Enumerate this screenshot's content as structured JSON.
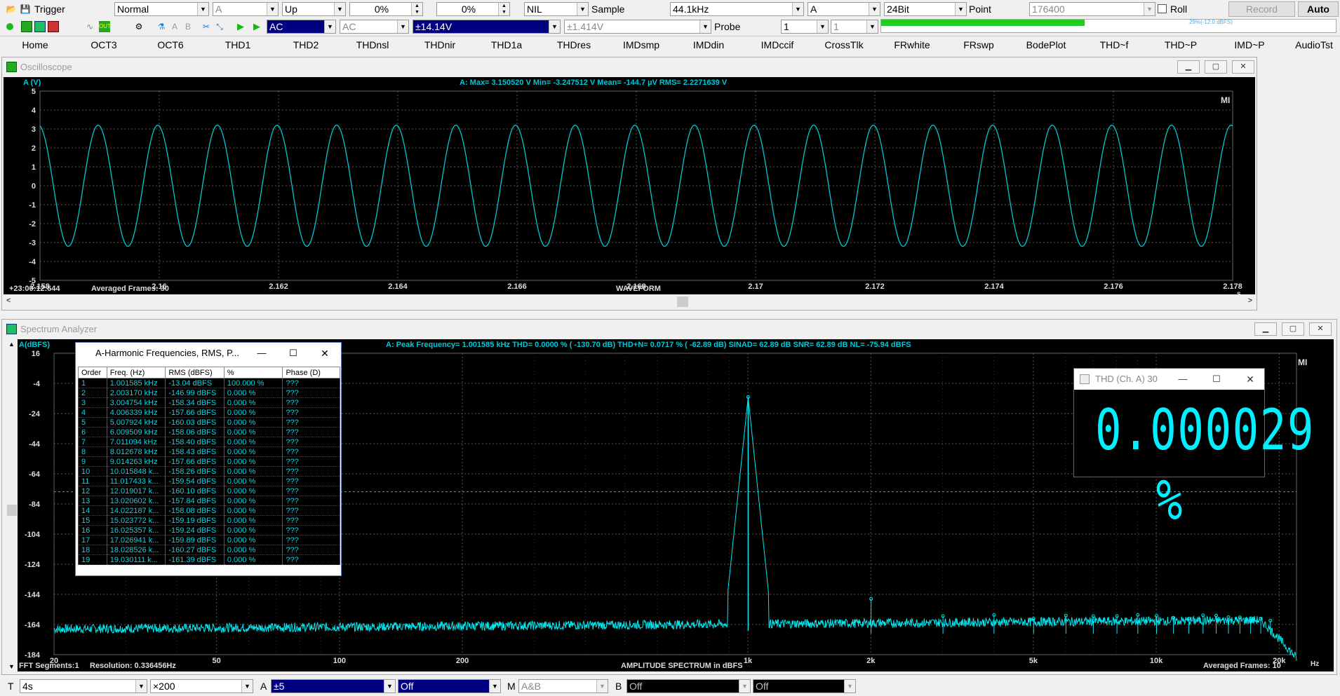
{
  "toolbar": {
    "trigger_label": "Trigger",
    "mode": "Normal",
    "channel": "A",
    "edge": "Up",
    "level1": "0%",
    "level2": "0%",
    "window": "NIL",
    "sample_label": "Sample",
    "sample_rate": "44.1kHz",
    "sample_channel": "A",
    "bits": "24Bit",
    "point_label": "Point",
    "points": "176400",
    "roll_label": "Roll",
    "record_label": "Record",
    "auto_label": "Auto",
    "coupling": "AC",
    "coupling2": "AC",
    "range": "±14.14V",
    "range2": "±1.414V",
    "probe_label": "Probe",
    "probe1": "1",
    "probe2": "1",
    "level_meter_text": "29%(-12.0 dBFS)"
  },
  "tabs": [
    "Home",
    "OCT3",
    "OCT6",
    "THD1",
    "THD2",
    "THDnsl",
    "THDnir",
    "THD1a",
    "THDres",
    "IMDsmp",
    "IMDdin",
    "IMDccif",
    "CrossTlk",
    "FRwhite",
    "FRswp",
    "BodePlot",
    "THD~f",
    "THD~P",
    "IMD~P",
    "AudioTst"
  ],
  "oscilloscope": {
    "title": "Oscilloscope",
    "y_unit": "A (V)",
    "stats": "A: Max=     3.150520   V Min=    -3.247512   V Mean=          -144.7   µV RMS=     2.2271639    V",
    "y_ticks": [
      "5",
      "4",
      "3",
      "2",
      "1",
      "0",
      "-1",
      "-2",
      "-3",
      "-4",
      "-5"
    ],
    "x_ticks": [
      "2.158",
      "2.16",
      "2.162",
      "2.164",
      "2.166",
      "2.168",
      "2.17",
      "2.172",
      "2.174",
      "2.176",
      "2.178"
    ],
    "x_unit": "s",
    "timestamp": "+23:00:12:644",
    "averaged": "Averaged Frames: 30",
    "x_label": "WAVEFORM",
    "mi": "MI",
    "cycles": 20,
    "amplitude": 3.2
  },
  "spectrum": {
    "title": "Spectrum Analyzer",
    "y_unit": "A(dBFS)",
    "stats": "A:  Peak Frequency=   1.001585   kHz  THD=     0.0000 % ( -130.70 dB)  THD+N=     0.0717 % (    -62.89 dB)  SINAD=     62.89 dB  SNR=     62.89 dB  NL=    -75.94 dBFS",
    "y_ticks": [
      "16",
      "-4",
      "-24",
      "-44",
      "-64",
      "-84",
      "-104",
      "-124",
      "-144",
      "-164",
      "-184"
    ],
    "x_ticks": [
      "20",
      "50",
      "100",
      "200",
      "1k",
      "2k",
      "5k",
      "10k",
      "20k"
    ],
    "x_unit": "Hz",
    "fft": "FFT Segments:1",
    "resolution": "Resolution:  0.336456Hz",
    "x_label": "AMPLITUDE SPECTRUM in dBFS",
    "averaged": "Averaged Frames: 10",
    "mi": "MI"
  },
  "harmonics": {
    "title": "A-Harmonic Frequencies, RMS, P...",
    "columns": [
      "Order",
      "Freq. (Hz)",
      "RMS (dBFS)",
      "%",
      "Phase (D)"
    ],
    "rows": [
      [
        "1",
        "1.001585 kHz",
        "-13.04 dBFS",
        "100.000  %",
        "???"
      ],
      [
        "2",
        "2.003170 kHz",
        "-146.99 dBFS",
        "0.000  %",
        "???"
      ],
      [
        "3",
        "3.004754 kHz",
        "-158.34 dBFS",
        "0.000  %",
        "???"
      ],
      [
        "4",
        "4.006339 kHz",
        "-157.66 dBFS",
        "0.000  %",
        "???"
      ],
      [
        "5",
        "5.007924 kHz",
        "-160.03 dBFS",
        "0.000  %",
        "???"
      ],
      [
        "6",
        "6.009509 kHz",
        "-158.06 dBFS",
        "0.000  %",
        "???"
      ],
      [
        "7",
        "7.011094 kHz",
        "-158.40 dBFS",
        "0.000  %",
        "???"
      ],
      [
        "8",
        "8.012678 kHz",
        "-158.43 dBFS",
        "0.000  %",
        "???"
      ],
      [
        "9",
        "9.014263 kHz",
        "-157.66 dBFS",
        "0.000  %",
        "???"
      ],
      [
        "10",
        "10.015848 k...",
        "-158.26 dBFS",
        "0.000  %",
        "???"
      ],
      [
        "11",
        "11.017433 k...",
        "-159.54 dBFS",
        "0.000  %",
        "???"
      ],
      [
        "12",
        "12.019017 k...",
        "-160.10 dBFS",
        "0.000  %",
        "???"
      ],
      [
        "13",
        "13.020602 k...",
        "-157.84 dBFS",
        "0.000  %",
        "???"
      ],
      [
        "14",
        "14.022187 k...",
        "-158.08 dBFS",
        "0.000  %",
        "???"
      ],
      [
        "15",
        "15.023772 k...",
        "-159.19 dBFS",
        "0.000  %",
        "???"
      ],
      [
        "16",
        "16.025357 k...",
        "-159.24 dBFS",
        "0.000  %",
        "???"
      ],
      [
        "17",
        "17.026941 k...",
        "-159.89 dBFS",
        "0.000  %",
        "???"
      ],
      [
        "18",
        "18.028526 k...",
        "-160.27 dBFS",
        "0.000  %",
        "???"
      ],
      [
        "19",
        "19.030111 k...",
        "-161.39 dBFS",
        "0.000  %",
        "???"
      ]
    ]
  },
  "thd_window": {
    "title": "THD (Ch. A)  30",
    "value": "0.000029 %"
  },
  "bottom": {
    "t_label": "T",
    "t_value": "4s",
    "zoom": "×200",
    "a_label": "A",
    "a_range": "±5",
    "a_off": "Off",
    "m_label": "M",
    "m_value": "A&B",
    "b_label": "B",
    "b_off": "Off",
    "b_off2": "Off"
  }
}
